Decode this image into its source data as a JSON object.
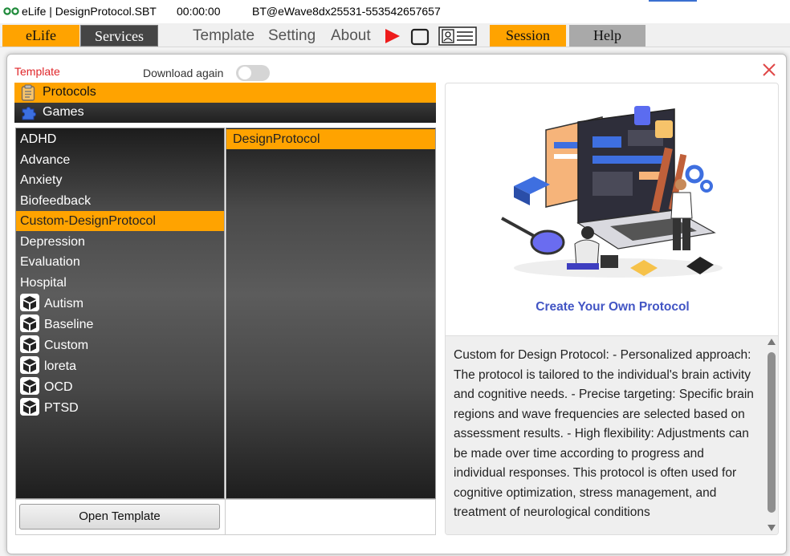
{
  "titlebar": {
    "app_title": "eLife | DesignProtocol.SBT",
    "timer": "00:00:00",
    "device": "BT@eWave8dx25531-553542657657"
  },
  "menubar": {
    "elife": "eLife",
    "services": "Services",
    "template": "Template",
    "setting": "Setting",
    "about": "About",
    "session": "Session",
    "help": "Help"
  },
  "dialog": {
    "title": "Template",
    "download_again": "Download again",
    "download_again_on": false,
    "categories": [
      "Protocols",
      "Games"
    ],
    "groups": [
      "ADHD",
      "Advance",
      "Anxiety",
      "Biofeedback",
      "Custom-DesignProtocol",
      "Depression",
      "Evaluation",
      "Hospital"
    ],
    "groups_with_icon": [
      "Autism",
      "Baseline",
      "Custom",
      "loreta",
      "OCD",
      "PTSD"
    ],
    "selected_group": "Custom-DesignProtocol",
    "templates": [
      "DesignProtocol"
    ],
    "open_button": "Open Template",
    "preview_caption": "Create Your Own Protocol",
    "description": "Custom for Design Protocol: - Personalized approach: The protocol is tailored to the individual's brain activity and cognitive needs. - Precise targeting: Specific brain regions and wave frequencies are selected based on assessment results. - High flexibility: Adjustments can be made over time according to progress and individual responses. This protocol is often used for cognitive optimization, stress management, and treatment of neurological conditions"
  },
  "colors": {
    "accent": "#ffa300",
    "close": "#e04848",
    "caption": "#4255c4"
  },
  "icons": [
    "infinity-icon",
    "play-icon",
    "stop-icon",
    "report-icon",
    "clipboard-icon",
    "puzzle-icon",
    "box-icon",
    "close-icon",
    "scroll-up-icon",
    "scroll-down-icon"
  ]
}
